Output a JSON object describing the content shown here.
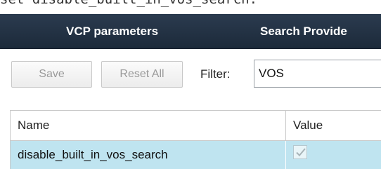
{
  "caption": "set disable_built_in_vos_search.",
  "tabs": [
    {
      "label": "VCP parameters"
    },
    {
      "label": "Search Provide"
    }
  ],
  "toolbar": {
    "save_label": "Save",
    "reset_label": "Reset All",
    "filter_label": "Filter:",
    "filter_value": "VOS"
  },
  "grid": {
    "columns": [
      "Name",
      "Value"
    ],
    "rows": [
      {
        "name": "disable_built_in_vos_search",
        "value_checked": true
      }
    ]
  },
  "icons": {
    "checkbox": "checkmark-icon"
  },
  "colors": {
    "tabbar_bg": "#22324a",
    "selected_row_bg": "#bfe4f0",
    "disabled_text": "#9a9a9a"
  }
}
